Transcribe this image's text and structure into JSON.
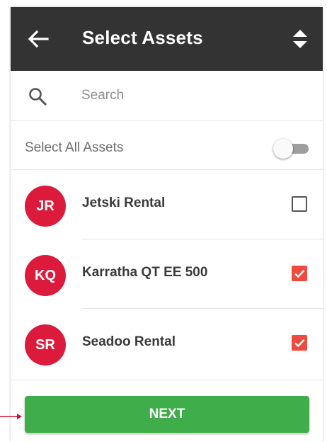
{
  "header": {
    "title": "Select Assets",
    "back_icon": "arrow-left-icon",
    "sort_icon": "sort-up-down-icon",
    "background": "#333333"
  },
  "search": {
    "placeholder": "Search",
    "value": "",
    "icon": "search-icon"
  },
  "select_all": {
    "label": "Select All Assets",
    "toggled": false
  },
  "assets": [
    {
      "initials": "JR",
      "name": "Jetski Rental",
      "checked": false
    },
    {
      "initials": "KQ",
      "name": "Karratha QT EE 500",
      "checked": true
    },
    {
      "initials": "SR",
      "name": "Seadoo Rental",
      "checked": true
    }
  ],
  "footer": {
    "next_label": "NEXT"
  },
  "colors": {
    "avatar": "#dc1a3c",
    "checkbox_checked": "#ee4a3e",
    "next_button": "#3fae4a",
    "annotation_arrow": "#c8102e"
  }
}
